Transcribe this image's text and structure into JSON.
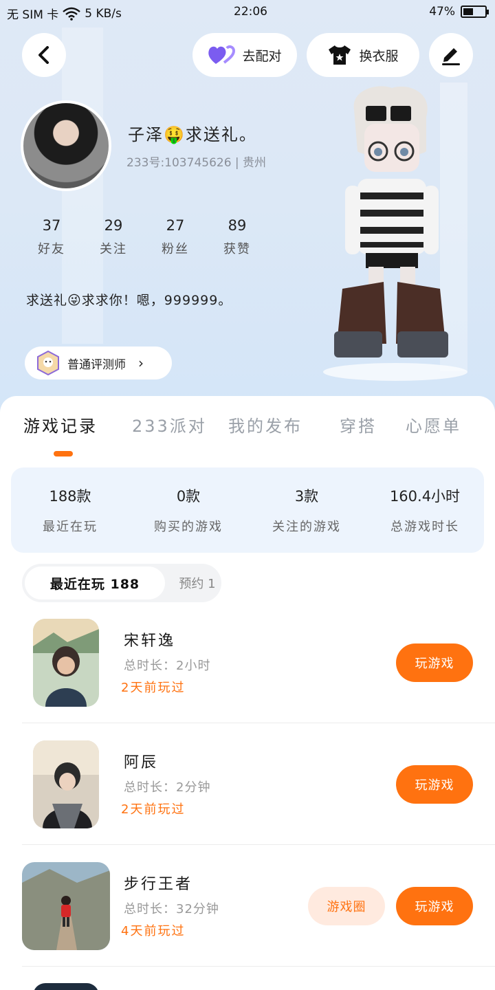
{
  "status_bar": {
    "carrier": "无 SIM 卡",
    "speed": "5 KB/s",
    "time": "22:06",
    "battery_text": "47%",
    "battery_level": 0.47
  },
  "header": {
    "pair_label": "去配对",
    "dress_label": "换衣服"
  },
  "profile": {
    "nickname": "子泽🤑求送礼。",
    "account": "233号:103745626 | 贵州",
    "stats": [
      {
        "num": "37",
        "label": "好友"
      },
      {
        "num": "29",
        "label": "关注"
      },
      {
        "num": "27",
        "label": "粉丝"
      },
      {
        "num": "89",
        "label": "获赞"
      }
    ],
    "bio": "求送礼😜求求你！嗯，999999。",
    "badge": "普通评测师"
  },
  "tabs": [
    "游戏记录",
    "233派对",
    "我的发布",
    "穿搭",
    "心愿单"
  ],
  "summary": [
    {
      "num": "188款",
      "label": "最近在玩"
    },
    {
      "num": "0款",
      "label": "购买的游戏"
    },
    {
      "num": "3款",
      "label": "关注的游戏"
    },
    {
      "num": "160.4小时",
      "label": "总游戏时长"
    }
  ],
  "segment": {
    "recent": "最近在玩 188",
    "reserve": "预约 1"
  },
  "games": [
    {
      "name": "宋轩逸",
      "duration": "总时长：2小时",
      "last_played": "2天前玩过",
      "play": "玩游戏"
    },
    {
      "name": "阿辰",
      "duration": "总时长：2分钟",
      "last_played": "2天前玩过",
      "play": "玩游戏"
    },
    {
      "name": "步行王者",
      "duration": "总时长：32分钟",
      "last_played": "4天前玩过",
      "play": "玩游戏",
      "circle": "游戏圈"
    }
  ],
  "colors": {
    "accent": "#ff7210",
    "accent_soft": "#ffeadf",
    "summary_bg": "#edf4fd",
    "hero_bg": "#dce8f6"
  },
  "icons": [
    "back-icon",
    "heart-pair-icon",
    "tshirt-icon",
    "edit-pen-icon",
    "wifi-icon",
    "battery-icon",
    "badge-avatar-icon",
    "chevron-right-icon"
  ]
}
